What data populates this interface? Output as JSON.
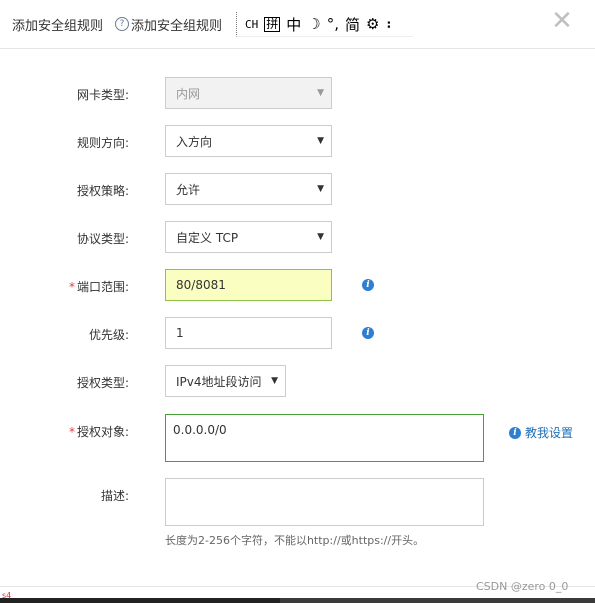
{
  "header": {
    "title": "添加安全组规则",
    "help_icon": "question-circle-icon",
    "help_link": "添加安全组规则",
    "ime": {
      "mode": "CH",
      "grid": "拼",
      "lang": "中",
      "moon": "☽",
      "punct": "°,",
      "simp": "简",
      "gear": "⚙",
      "more": "⠆"
    },
    "close": "✕"
  },
  "form": {
    "nic_type": {
      "label": "网卡类型:",
      "value": "内网"
    },
    "direction": {
      "label": "规则方向:",
      "value": "入方向"
    },
    "policy": {
      "label": "授权策略:",
      "value": "允许"
    },
    "protocol": {
      "label": "协议类型:",
      "value": "自定义 TCP"
    },
    "port_range": {
      "required": "*",
      "label": "端口范围:",
      "value": "80/8081"
    },
    "priority": {
      "label": "优先级:",
      "value": "1"
    },
    "auth_type": {
      "label": "授权类型:",
      "value": "IPv4地址段访问"
    },
    "auth_object": {
      "required": "*",
      "label": "授权对象:",
      "value": "0.0.0.0/0",
      "help": "教我设置"
    },
    "description": {
      "label": "描述:",
      "value": "",
      "hint": "长度为2-256个字符，不能以http://或https://开头。"
    }
  },
  "icons": {
    "info": "i",
    "dropdown": "▼"
  },
  "colors": {
    "accent": "#2d7fd1",
    "required": "#e53f3f",
    "highlight": "#fafec0"
  },
  "watermark": "CSDN @zero 0_0",
  "corner_mark": "s4"
}
